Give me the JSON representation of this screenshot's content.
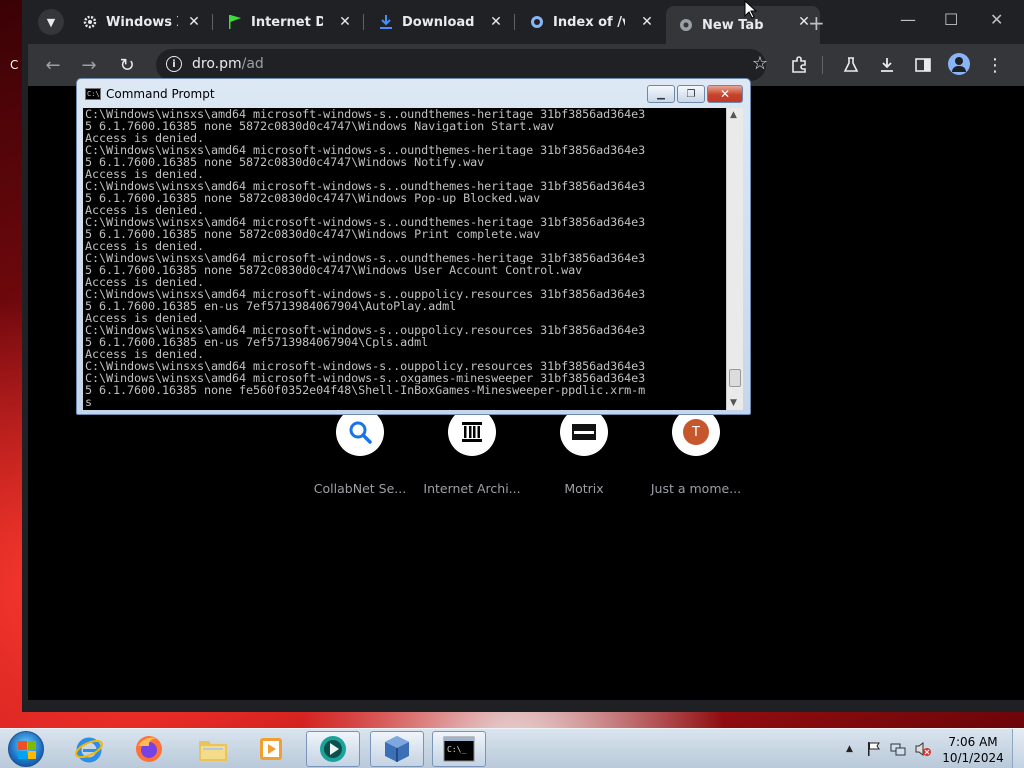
{
  "desktop": {
    "partial_label": "C"
  },
  "browser": {
    "tabs": [
      {
        "title": "Windows XP",
        "icon": "gear-icon"
      },
      {
        "title": "Internet Dow",
        "icon": "green-flag-icon"
      },
      {
        "title": "Downloads",
        "icon": "download-icon"
      },
      {
        "title": "Index of /vm",
        "icon": "page-icon"
      },
      {
        "title": "New Tab",
        "icon": "chrome-icon",
        "active": true
      }
    ],
    "url_host": "dro.pm",
    "url_path": "/ad",
    "shortcuts": [
      {
        "label": "CollabNet Se...",
        "icon": "search-icon"
      },
      {
        "label": "Internet Archi...",
        "icon": "archive-icon"
      },
      {
        "label": "Motrix",
        "icon": "motrix-icon"
      },
      {
        "label": "Just a mome...",
        "icon": "letter-t-icon",
        "letter": "T"
      }
    ]
  },
  "cmd": {
    "title": "Command Prompt",
    "icon_text": "C:\\",
    "lines": [
      "C:\\Windows\\winsxs\\amd64_microsoft-windows-s..oundthemes-heritage_31bf3856ad364e3",
      "5_6.1.7600.16385_none_5872c0830d0c4747\\Windows Navigation Start.wav",
      "Access is denied.",
      "C:\\Windows\\winsxs\\amd64_microsoft-windows-s..oundthemes-heritage_31bf3856ad364e3",
      "5_6.1.7600.16385_none_5872c0830d0c4747\\Windows Notify.wav",
      "Access is denied.",
      "C:\\Windows\\winsxs\\amd64_microsoft-windows-s..oundthemes-heritage_31bf3856ad364e3",
      "5_6.1.7600.16385_none_5872c0830d0c4747\\Windows Pop-up Blocked.wav",
      "Access is denied.",
      "C:\\Windows\\winsxs\\amd64_microsoft-windows-s..oundthemes-heritage_31bf3856ad364e3",
      "5_6.1.7600.16385_none_5872c0830d0c4747\\Windows Print complete.wav",
      "Access is denied.",
      "C:\\Windows\\winsxs\\amd64_microsoft-windows-s..oundthemes-heritage_31bf3856ad364e3",
      "5_6.1.7600.16385_none_5872c0830d0c4747\\Windows User Account Control.wav",
      "Access is denied.",
      "C:\\Windows\\winsxs\\amd64_microsoft-windows-s..ouppolicy.resources_31bf3856ad364e3",
      "5_6.1.7600.16385_en-us_7ef5713984067904\\AutoPlay.adml",
      "Access is denied.",
      "C:\\Windows\\winsxs\\amd64_microsoft-windows-s..ouppolicy.resources_31bf3856ad364e3",
      "5_6.1.7600.16385_en-us_7ef5713984067904\\Cpls.adml",
      "Access is denied.",
      "C:\\Windows\\winsxs\\amd64_microsoft-windows-s..ouppolicy.resources_31bf3856ad364e3",
      "C:\\Windows\\winsxs\\amd64_microsoft-windows-s..oxgames-minesweeper_31bf3856ad364e3",
      "5_6.1.7600.16385_none_fe560f0352e04f48\\Shell-InBoxGames-Minesweeper-ppdlic.xrm-m",
      "s"
    ]
  },
  "taskbar": {
    "apps": [
      {
        "name": "internet-explorer-icon"
      },
      {
        "name": "firefox-icon"
      },
      {
        "name": "file-explorer-icon"
      },
      {
        "name": "media-player-icon"
      },
      {
        "name": "teams-icon"
      },
      {
        "name": "virtualbox-icon"
      },
      {
        "name": "command-prompt-icon",
        "active": true
      }
    ],
    "time": "7:06 AM",
    "date": "10/1/2024",
    "tray_arrow": "▲"
  },
  "colors": {
    "chrome_dark": "#202124",
    "chrome_toolbar": "#35363a",
    "cmd_text": "#c0c0c0"
  }
}
